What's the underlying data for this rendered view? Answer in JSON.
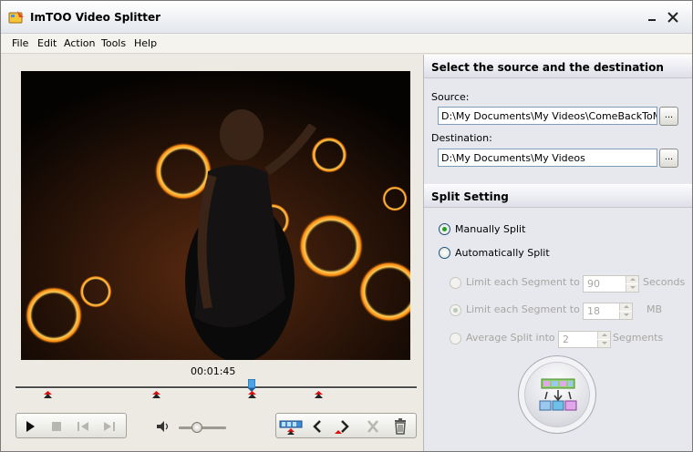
{
  "window": {
    "title": "ImTOO Video Splitter"
  },
  "menu": [
    "File",
    "Edit",
    "Action",
    "Tools",
    "Help"
  ],
  "player": {
    "time": "00:01:45",
    "progress_fraction": 0.59
  },
  "source_dest": {
    "heading": "Select the source and the destination",
    "source_label": "Source:",
    "source_value": "D:\\My Documents\\My Videos\\ComeBackToMe",
    "destination_label": "Destination:",
    "destination_value": "D:\\My Documents\\My Videos",
    "browse_label": "..."
  },
  "split": {
    "heading": "Split Setting",
    "manual_label": "Manually Split",
    "auto_label": "Automatically Split",
    "limit_seconds_label": "Limit each Segment to",
    "limit_seconds_value": "90",
    "seconds_unit": "Seconds",
    "limit_mb_label": "Limit each Segment to",
    "limit_mb_value": "18",
    "mb_unit": "MB",
    "average_label": "Average Split into",
    "average_value": "2",
    "segments_unit": "Segments",
    "selected_mode": "manual"
  }
}
